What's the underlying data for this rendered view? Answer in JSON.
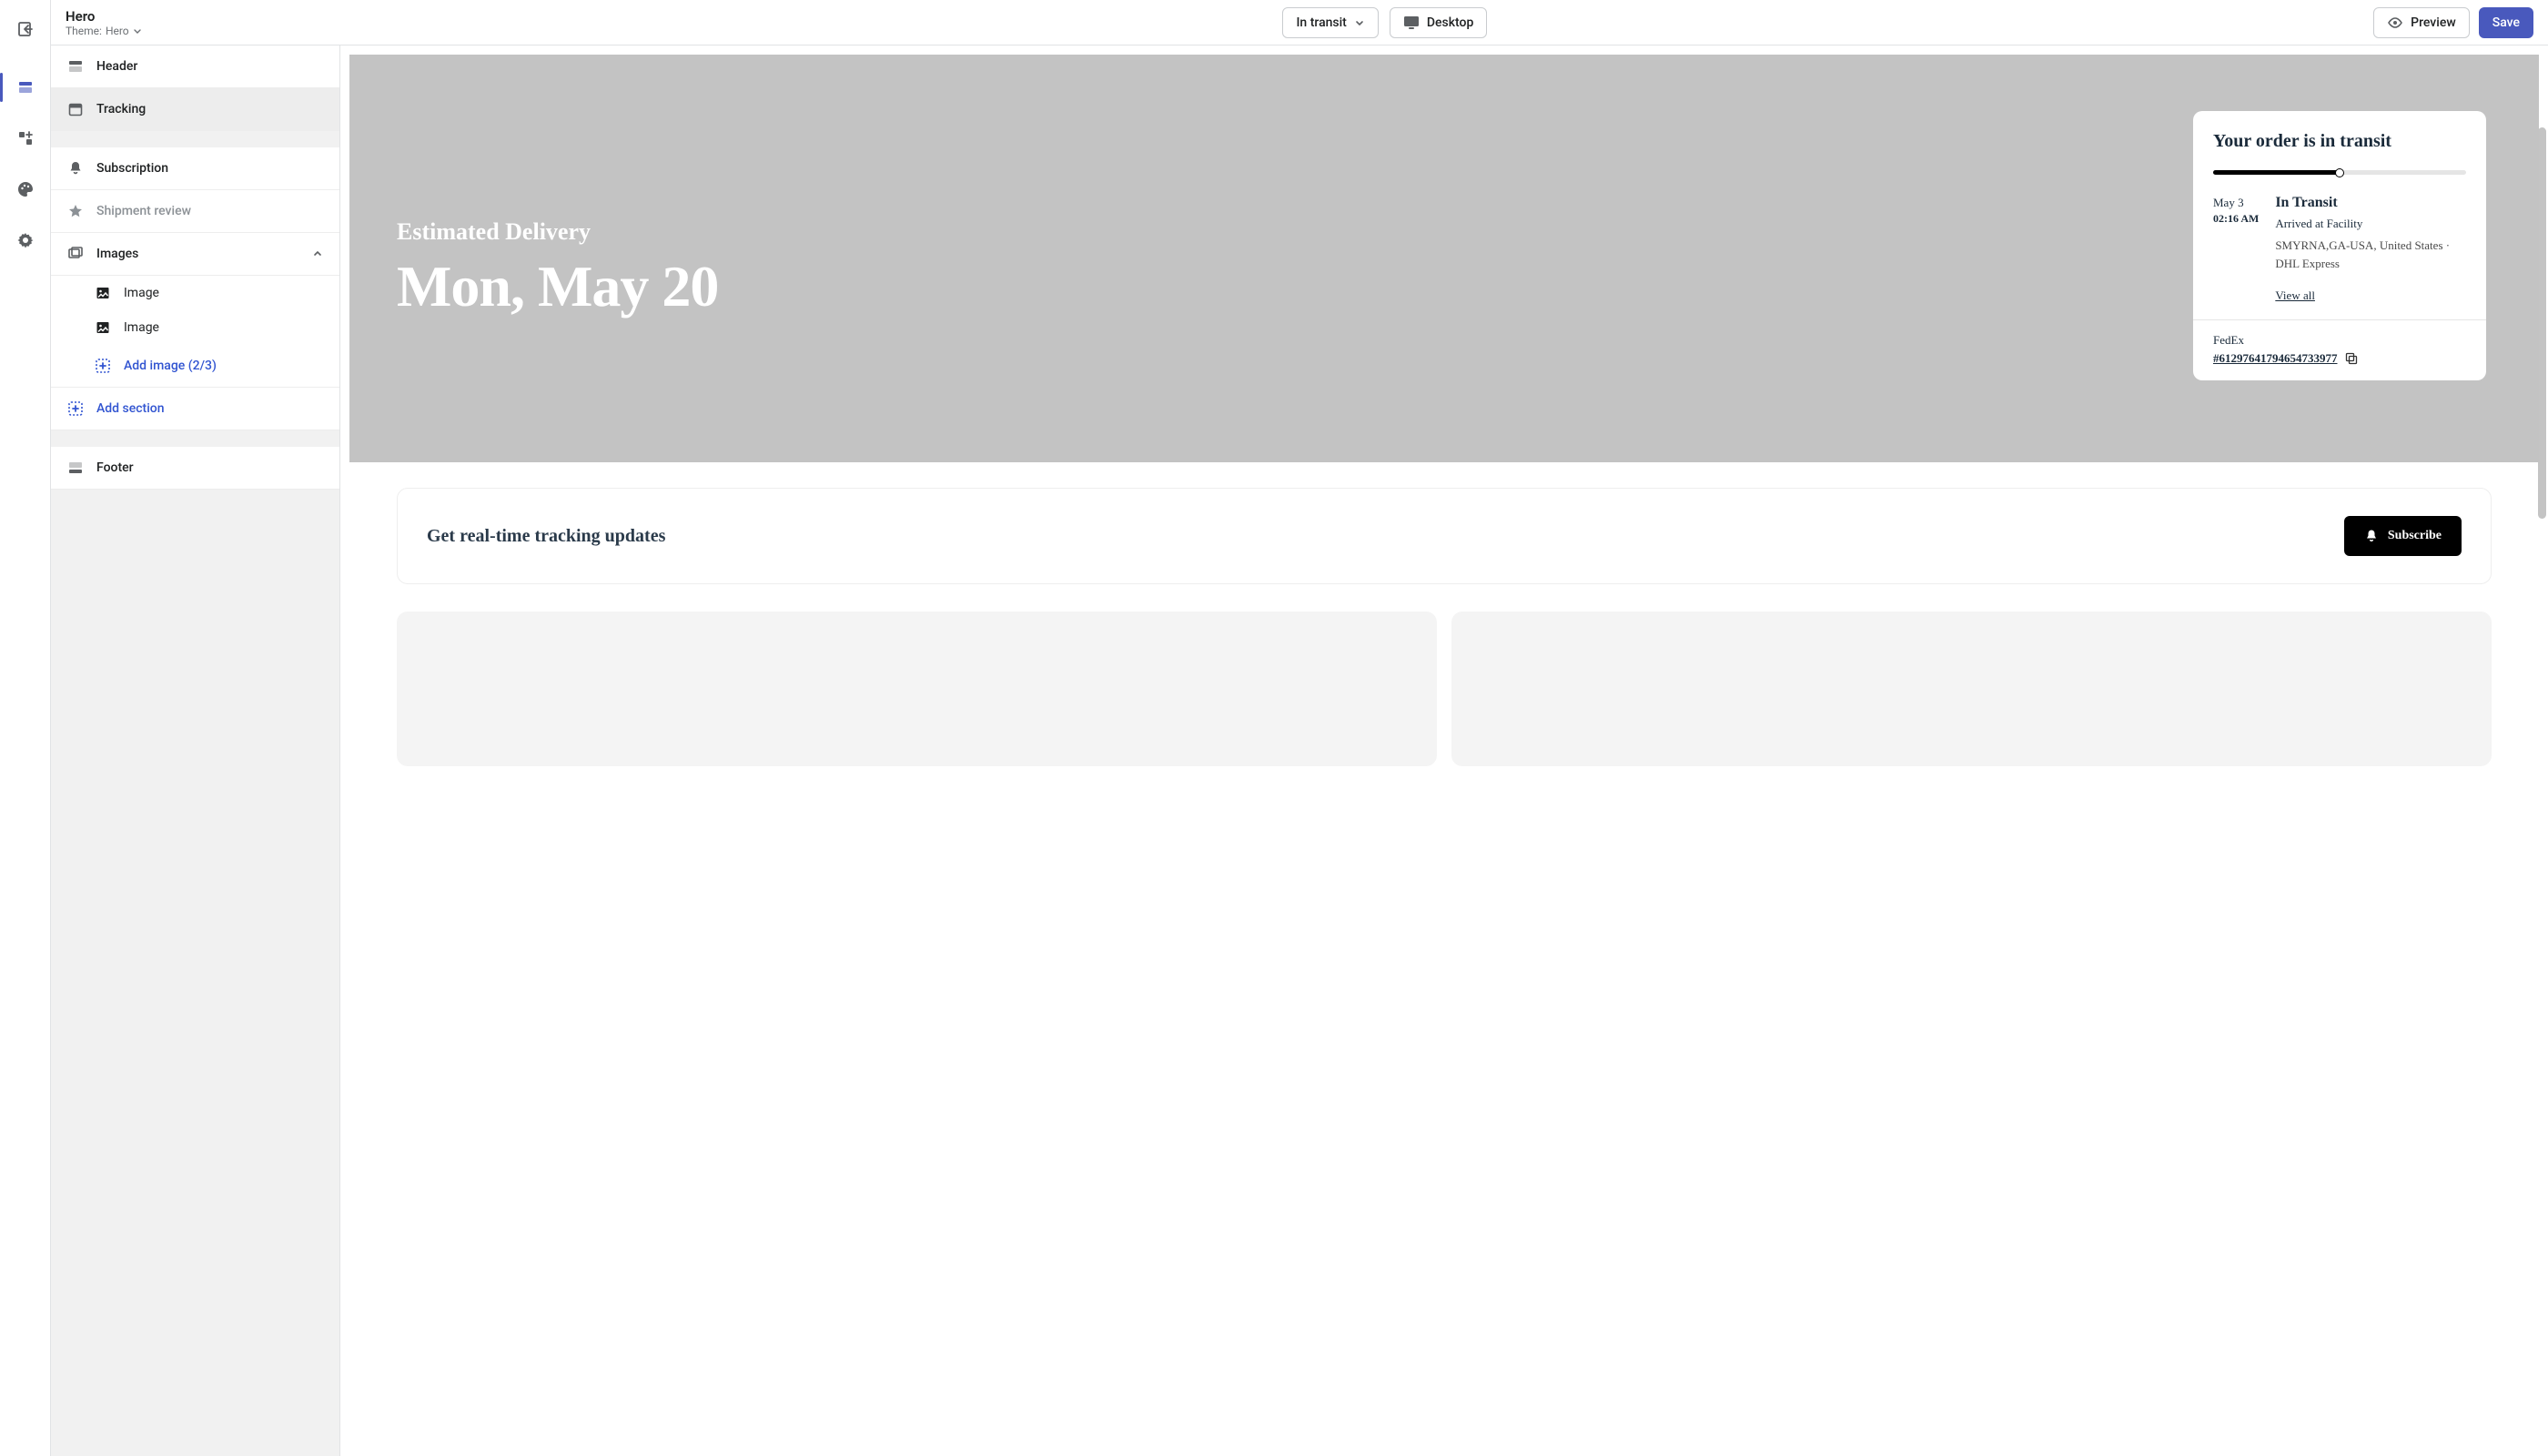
{
  "page": {
    "title": "Hero",
    "theme_prefix": "Theme:",
    "theme_name": "Hero"
  },
  "toolbar": {
    "status_dropdown": "In transit",
    "device_btn": "Desktop",
    "preview_btn": "Preview",
    "save_btn": "Save"
  },
  "sidebar": {
    "header": "Header",
    "tracking": "Tracking",
    "subscription": "Subscription",
    "shipment_review": "Shipment review",
    "images": "Images",
    "image_item": "Image",
    "add_image": "Add image (2/3)",
    "add_section": "Add section",
    "footer": "Footer"
  },
  "preview": {
    "delivery_label": "Estimated Delivery",
    "delivery_date": "Mon, May 20",
    "order_title": "Your order is in transit",
    "status_date": "May 3",
    "status_time": "02:16 AM",
    "status_name": "In Transit",
    "status_line": "Arrived at Facility",
    "status_loc": "SMYRNA,GA-USA, United States · DHL Express",
    "view_all": "View all",
    "carrier": "FedEx",
    "tracking_no": "#61297641794654733977",
    "subscribe_title": "Get real-time tracking updates",
    "subscribe_btn": "Subscribe"
  }
}
